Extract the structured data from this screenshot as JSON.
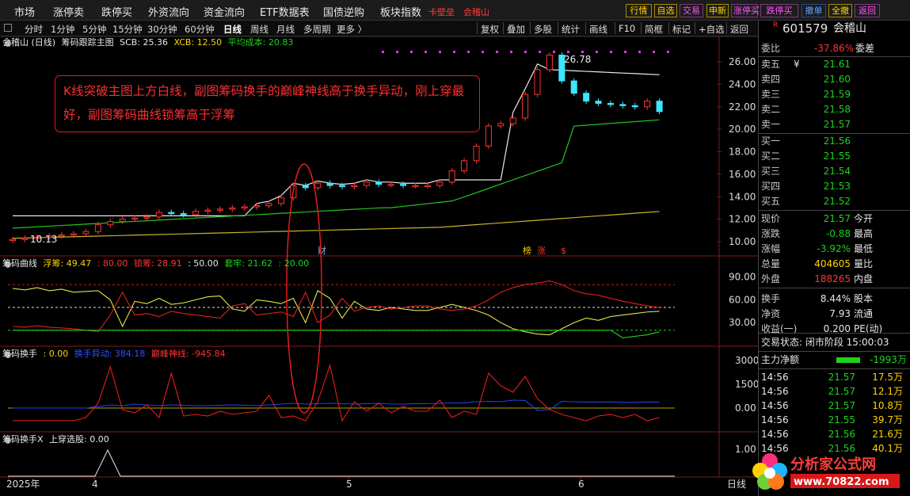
{
  "menubar": {
    "items": [
      "市场",
      "涨停卖",
      "跌停买",
      "外资流向",
      "资金流向",
      "ETF数据表",
      "国债逆购",
      "板块指数"
    ],
    "red_items": [
      "卡壁垒",
      "会稽山"
    ],
    "right_buttons": [
      "行情",
      "自选",
      "交易",
      "申新",
      "涨停买",
      "跌停买",
      "撤单",
      "全撤",
      "返回"
    ]
  },
  "toolbar": {
    "periods": [
      "分时",
      "1分钟",
      "5分钟",
      "15分钟",
      "30分钟",
      "60分钟",
      "日线",
      "周线",
      "月线",
      "多周期",
      "更多 〉"
    ],
    "active": "日线",
    "right": [
      "复权",
      "叠加",
      "多股",
      "统计",
      "画线",
      "F10",
      "简框",
      "标记",
      "+自选",
      "返回"
    ]
  },
  "main_info": {
    "name": "会稽山 (日线)",
    "indicator": "筹码跟踪主图",
    "scb": "SCB: 25.36",
    "xcb": "XCB: 12.50",
    "avg": "平均成本: 20.83"
  },
  "annotation": "K线突破主图上方白线，副图筹码换手的巅峰神线高于换手异动，刚上穿最好，副图筹码曲线锁筹高于浮筹",
  "price_labels": {
    "high": "26.78",
    "low": "10.13"
  },
  "events": {
    "cai": "财",
    "bang": "榜",
    "zhang": "涨",
    "s": "$"
  },
  "panel1": {
    "title": "筹码曲线",
    "fuchou": "浮筹: 49.47",
    "v80": ": 80.00",
    "suochou": "锁筹: 28.91",
    "v50": ": 50.00",
    "taolao": "套牢: 21.62",
    "v20": ": 20.00"
  },
  "panel2": {
    "title": "筹码换手",
    "v0": ": 0.00",
    "huanshou": "换手异动: 384.18",
    "dianfeng": "巅峰神线: -945.84"
  },
  "panel3": {
    "title": "筹码换手X",
    "shangchuan": "上穿选股: 0.00"
  },
  "axes": {
    "main": [
      "26.00",
      "24.00",
      "22.00",
      "20.00",
      "18.00",
      "16.00",
      "14.00",
      "12.00",
      "10.00"
    ],
    "p1": [
      "90.00",
      "60.00",
      "30.00"
    ],
    "p2": [
      "3000",
      "1500",
      "0.00"
    ],
    "p3": [
      "1.00"
    ],
    "dates": [
      "2025年",
      "4",
      "5",
      "6"
    ],
    "corner": "日线"
  },
  "right": {
    "code": "601579",
    "name": "会稽山",
    "weibi_label": "委比",
    "weibi": "-37.86%",
    "weicha": "委差",
    "asks": [
      {
        "l": "卖五",
        "p": "21.61"
      },
      {
        "l": "卖四",
        "p": "21.60"
      },
      {
        "l": "卖三",
        "p": "21.59"
      },
      {
        "l": "卖二",
        "p": "21.58"
      },
      {
        "l": "卖一",
        "p": "21.57"
      }
    ],
    "bids": [
      {
        "l": "买一",
        "p": "21.56"
      },
      {
        "l": "买二",
        "p": "21.55"
      },
      {
        "l": "买三",
        "p": "21.54"
      },
      {
        "l": "买四",
        "p": "21.53"
      },
      {
        "l": "买五",
        "p": "21.52"
      }
    ],
    "stats": [
      {
        "a": "现价",
        "b": "21.57",
        "c": "今开"
      },
      {
        "a": "涨跌",
        "b": "-0.88",
        "c": "最高"
      },
      {
        "a": "涨幅",
        "b": "-3.92%",
        "c": "最低"
      },
      {
        "a": "总量",
        "b": "404605",
        "c": "量比"
      },
      {
        "a": "外盘",
        "b": "188265",
        "c": "内盘"
      },
      {
        "a": "换手",
        "b": "8.44%",
        "c": "股本"
      },
      {
        "a": "净资",
        "b": "7.93",
        "c": "流通"
      },
      {
        "a": "收益(一)",
        "b": "0.200",
        "c": "PE(动)"
      }
    ],
    "status": "交易状态: 闭市阶段 15:00:03",
    "zhuli_label": "主力净额",
    "zhuli": "-1993万",
    "ticks": [
      {
        "t": "14:56",
        "p": "21.57",
        "v": "17.5万"
      },
      {
        "t": "14:56",
        "p": "21.57",
        "v": "12.1万"
      },
      {
        "t": "14:56",
        "p": "21.57",
        "v": "10.8万"
      },
      {
        "t": "14:56",
        "p": "21.55",
        "v": "39.7万"
      },
      {
        "t": "14:56",
        "p": "21.56",
        "v": "21.6万"
      },
      {
        "t": "14:56",
        "p": "21.56",
        "v": "40.1万"
      }
    ]
  },
  "watermark": {
    "line1": "分析家公式网",
    "line2": "www.70822.com"
  },
  "colors": {
    "up": "#ff3333",
    "down": "#3ce6ff",
    "ma_green": "#22c322",
    "ma_yellow": "#c8b428",
    "white": "#e8e8e8"
  },
  "chart_data": {
    "type": "candlestick",
    "close": [
      10.2,
      10.3,
      10.4,
      10.5,
      10.6,
      10.7,
      10.9,
      11.5,
      11.8,
      12.0,
      12.1,
      12.2,
      12.6,
      12.5,
      12.4,
      12.7,
      12.8,
      12.9,
      13.0,
      13.1,
      13.2,
      13.4,
      13.9,
      15.0,
      14.8,
      15.2,
      15.0,
      14.9,
      15.0,
      15.3,
      15.1,
      15.1,
      15.0,
      15.0,
      15.0,
      15.3,
      16.3,
      17.2,
      18.5,
      20.3,
      20.5,
      21.0,
      23.1,
      25.3,
      26.6,
      24.3,
      23.2,
      22.5,
      22.3,
      22.2,
      22.1,
      22.0,
      22.5,
      21.57
    ]
  }
}
